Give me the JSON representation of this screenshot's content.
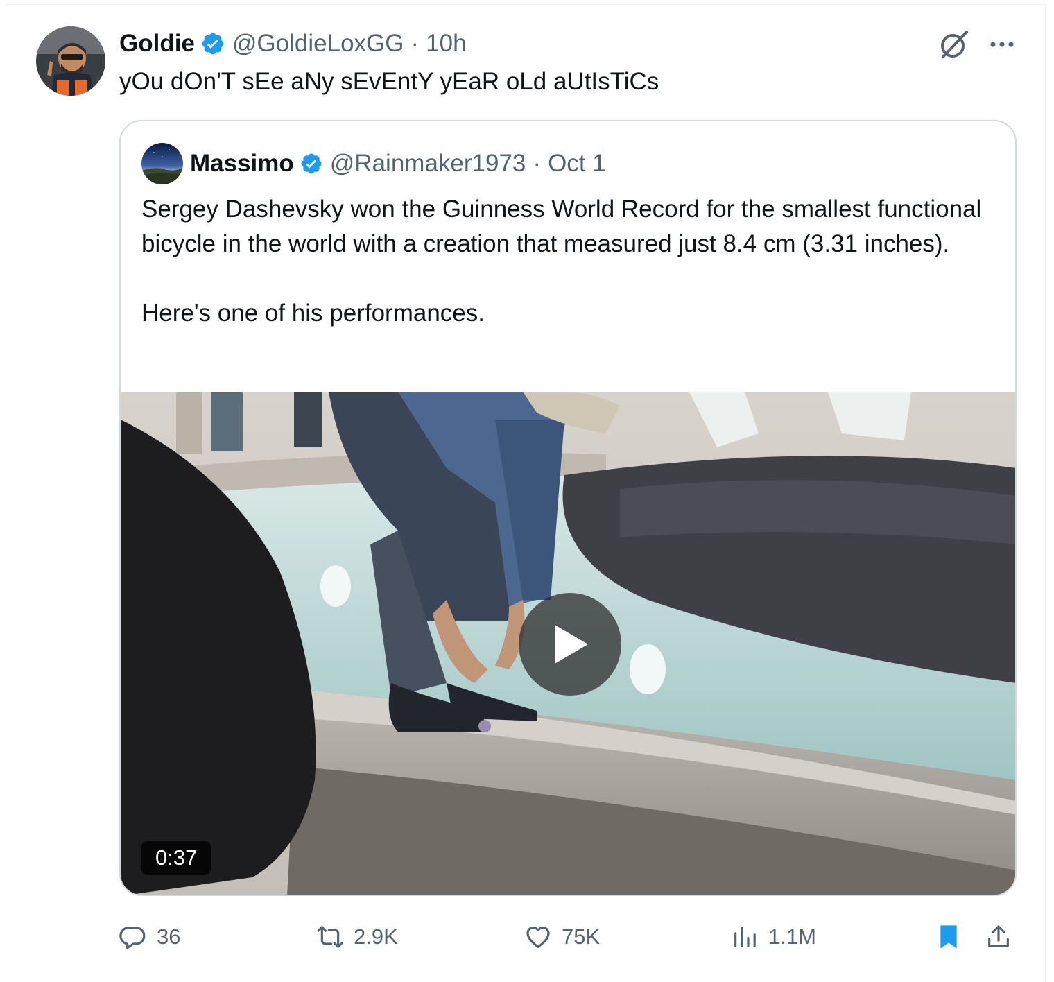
{
  "tweet": {
    "author_name": "Goldie",
    "handle": "@GoldieLoxGG",
    "separator": "·",
    "time": "10h",
    "text": "yOu dOn'T sEe aNy sEvEntY yEaR oLd aUtIsTiCs",
    "verified_color": "#1d9bf0",
    "icons": [
      "grok-icon",
      "more-icon"
    ]
  },
  "quote": {
    "author_name": "Massimo",
    "handle": "@Rainmaker1973",
    "separator": "·",
    "date": "Oct 1",
    "paragraphs": [
      "Sergey Dashevsky won the Guinness World Record for the smallest functional bicycle in the world with a creation that measured just 8.4 cm (3.31 inches).",
      "Here's one of his performances."
    ],
    "video": {
      "duration": "0:37",
      "icon": "play-icon"
    }
  },
  "actions": {
    "replies": "36",
    "reposts": "2.9K",
    "likes": "75K",
    "views": "1.1M",
    "bookmark_color": "#1d9bf0",
    "icons": [
      "reply-icon",
      "repost-icon",
      "like-icon",
      "views-icon",
      "bookmark-icon",
      "share-icon"
    ]
  }
}
